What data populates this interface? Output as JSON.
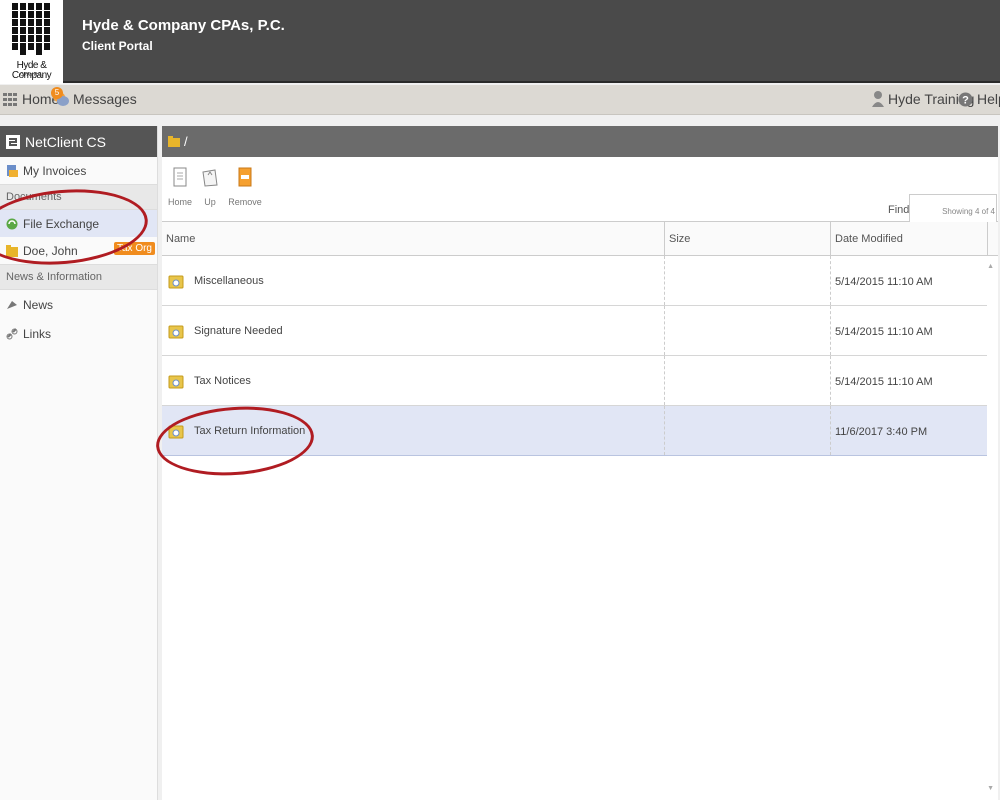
{
  "header": {
    "logo_text": "Hyde & Company",
    "logo_sub": "CPAs P.C.",
    "firm_name": "Hyde & Company CPAs, P.C.",
    "portal_name": "Client Portal"
  },
  "topnav": {
    "home_label": "Home",
    "messages_label": "Messages",
    "messages_badge": "5",
    "user_label": "Hyde Training",
    "help_label": "Help"
  },
  "sidebar": {
    "title": "NetClient CS",
    "invoices": "My Invoices",
    "documents_section": "Documents",
    "file_exchange": "File Exchange",
    "doe_john": "Doe, John",
    "tax_org": "Tax Org",
    "news_section": "News & Information",
    "news": "News",
    "links": "Links"
  },
  "main": {
    "path": "/",
    "toolbar": {
      "home": "Home",
      "up": "Up",
      "remove": "Remove",
      "find_label": "Find:",
      "find_value": "",
      "showing": "Showing 4 of 4"
    },
    "columns": {
      "name": "Name",
      "size": "Size",
      "date": "Date Modified"
    },
    "rows": [
      {
        "name": "Miscellaneous",
        "size": "",
        "date": "5/14/2015 11:10 AM"
      },
      {
        "name": "Signature Needed",
        "size": "",
        "date": "5/14/2015 11:10 AM"
      },
      {
        "name": "Tax Notices",
        "size": "",
        "date": "5/14/2015 11:10 AM"
      },
      {
        "name": "Tax Return Information",
        "size": "",
        "date": "11/6/2017 3:40 PM"
      }
    ]
  },
  "colors": {
    "header_bg": "#4a4a4a",
    "accent_orange": "#f08c1e",
    "selected_row": "#e1e6f5",
    "annotation_red": "#b01c22"
  }
}
